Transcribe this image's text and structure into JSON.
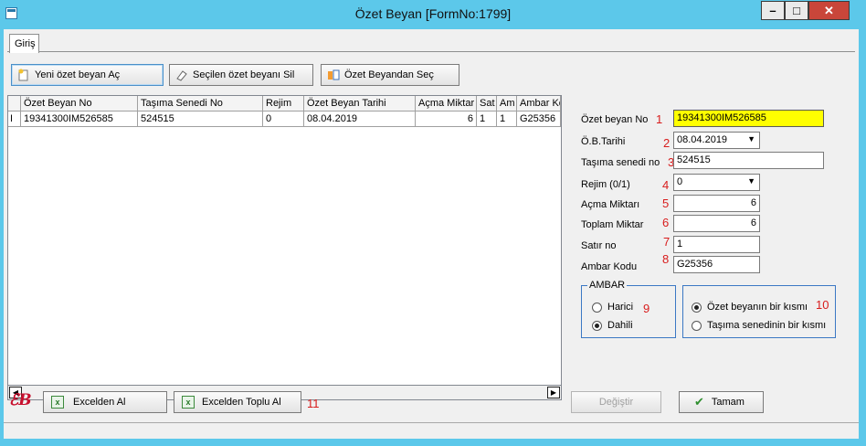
{
  "window": {
    "title": "Özet Beyan [FormNo:1799]",
    "min_glyph": "–",
    "max_glyph": "□",
    "close_glyph": "✕"
  },
  "tabs": [
    {
      "label": "Giriş"
    }
  ],
  "toolbar": {
    "new_label": "Yeni özet beyan Aç",
    "delete_label": "Seçilen özet beyanı Sil",
    "select_label": "Özet Beyandan Seç"
  },
  "grid": {
    "columns": [
      "Özet Beyan No",
      "Taşıma Senedi No",
      "Rejim",
      "Özet Beyan Tarihi",
      "Açma Miktar",
      "Sat",
      "Am",
      "Ambar Kc"
    ],
    "rows": [
      {
        "marker": "I",
        "cells": [
          "19341300IM526585",
          "524515",
          "0",
          "08.04.2019",
          "6",
          "1",
          "1",
          "G25356"
        ]
      }
    ],
    "scroll_left": "◀",
    "scroll_right": "▶"
  },
  "form": {
    "ozet_beyan_no": {
      "label": "Özet beyan No",
      "num": "1",
      "value": "19341300IM526585"
    },
    "ob_tarihi": {
      "label": "Ö.B.Tarihi",
      "num": "2",
      "value": "08.04.2019"
    },
    "tasima_senedi": {
      "label": "Taşıma senedi no",
      "num": "3",
      "value": "524515"
    },
    "rejim": {
      "label": "Rejim  (0/1)",
      "num": "4",
      "value": "0"
    },
    "acma_miktari": {
      "label": "Açma Miktarı",
      "num": "5",
      "value": "6"
    },
    "toplam_miktar": {
      "label": "Toplam Miktar",
      "num": "6",
      "value": "6"
    },
    "satir_no": {
      "label": "Satır no",
      "num": "7",
      "value": "1"
    },
    "ambar_kodu": {
      "label": "Ambar Kodu",
      "num": "8",
      "value": "G25356"
    },
    "dropdown_glyph": "▼"
  },
  "ambar_group": {
    "title": "AMBAR",
    "num": "9",
    "options": [
      {
        "label": "Harici",
        "selected": false
      },
      {
        "label": "Dahili",
        "selected": true
      }
    ]
  },
  "kisim_group": {
    "num": "10",
    "options": [
      {
        "label": "Özet beyanın bir kısmı",
        "selected": true
      },
      {
        "label": "Taşıma senedinin bir kısmı",
        "selected": false
      }
    ]
  },
  "bottom": {
    "logo_text": "ℰB",
    "excel_label": "Excelden Al",
    "excel_bulk_label": "Excelden Toplu Al",
    "num_11": "11",
    "change_label": "Değiştir",
    "ok_label": "Tamam",
    "ok_glyph": "✔",
    "excel_icon_glyph": "x"
  },
  "colors": {
    "title_bar": "#5cc8ea",
    "highlight_field": "#ffff00",
    "annotation_red": "#d81c1c",
    "close_button": "#c9463a"
  }
}
